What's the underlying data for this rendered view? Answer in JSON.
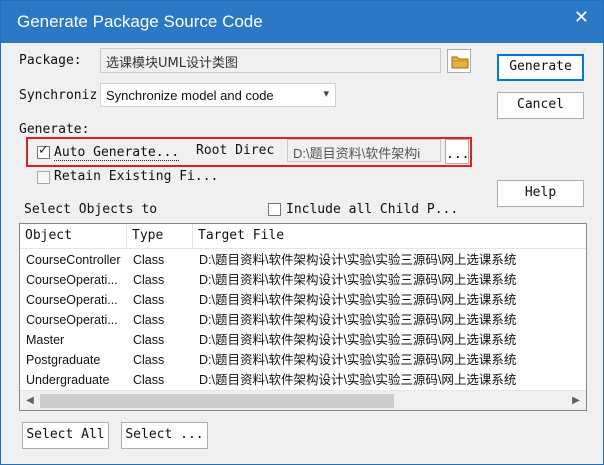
{
  "window": {
    "title": "Generate Package Source Code",
    "close_glyph": "✕"
  },
  "package": {
    "label": "Package:",
    "value": "选课模块UML设计类图"
  },
  "synchronize": {
    "label": "Synchroniz",
    "value": "Synchronize model and code",
    "arrow": "▾"
  },
  "generate": {
    "label": "Generate:",
    "auto_generate_label": "Auto Generate...",
    "auto_generate_checked": true,
    "root_label": "Root Direct",
    "root_path": "D:\\题目资料\\软件架构i",
    "browse_label": "...",
    "retain_label": "Retain Existing Fi...",
    "retain_checked": false
  },
  "select_objects": {
    "label": "Select Objects to",
    "include_child_label": "Include all Child P...",
    "include_child_checked": false
  },
  "buttons": {
    "generate": "Generate",
    "cancel": "Cancel",
    "help": "Help",
    "select_all": "Select All",
    "select_none": "Select ..."
  },
  "list": {
    "columns": [
      "Object",
      "Type",
      "Target File"
    ],
    "rows": [
      {
        "object": "CourseController",
        "type": "Class",
        "target": "D:\\题目资料\\软件架构设计\\实验\\实验三源码\\网上选课系统"
      },
      {
        "object": "CourseOperati...",
        "type": "Class",
        "target": "D:\\题目资料\\软件架构设计\\实验\\实验三源码\\网上选课系统"
      },
      {
        "object": "CourseOperati...",
        "type": "Class",
        "target": "D:\\题目资料\\软件架构设计\\实验\\实验三源码\\网上选课系统"
      },
      {
        "object": "CourseOperati...",
        "type": "Class",
        "target": "D:\\题目资料\\软件架构设计\\实验\\实验三源码\\网上选课系统"
      },
      {
        "object": "Master",
        "type": "Class",
        "target": "D:\\题目资料\\软件架构设计\\实验\\实验三源码\\网上选课系统"
      },
      {
        "object": "Postgraduate",
        "type": "Class",
        "target": "D:\\题目资料\\软件架构设计\\实验\\实验三源码\\网上选课系统"
      },
      {
        "object": "Undergraduate",
        "type": "Class",
        "target": "D:\\题目资料\\软件架构设计\\实验\\实验三源码\\网上选课系统"
      }
    ],
    "scroll_left": "◀",
    "scroll_right": "▶"
  },
  "colors": {
    "titlebar": "#2b78c5",
    "highlight": "#e02020",
    "accent": "#0078d7"
  }
}
